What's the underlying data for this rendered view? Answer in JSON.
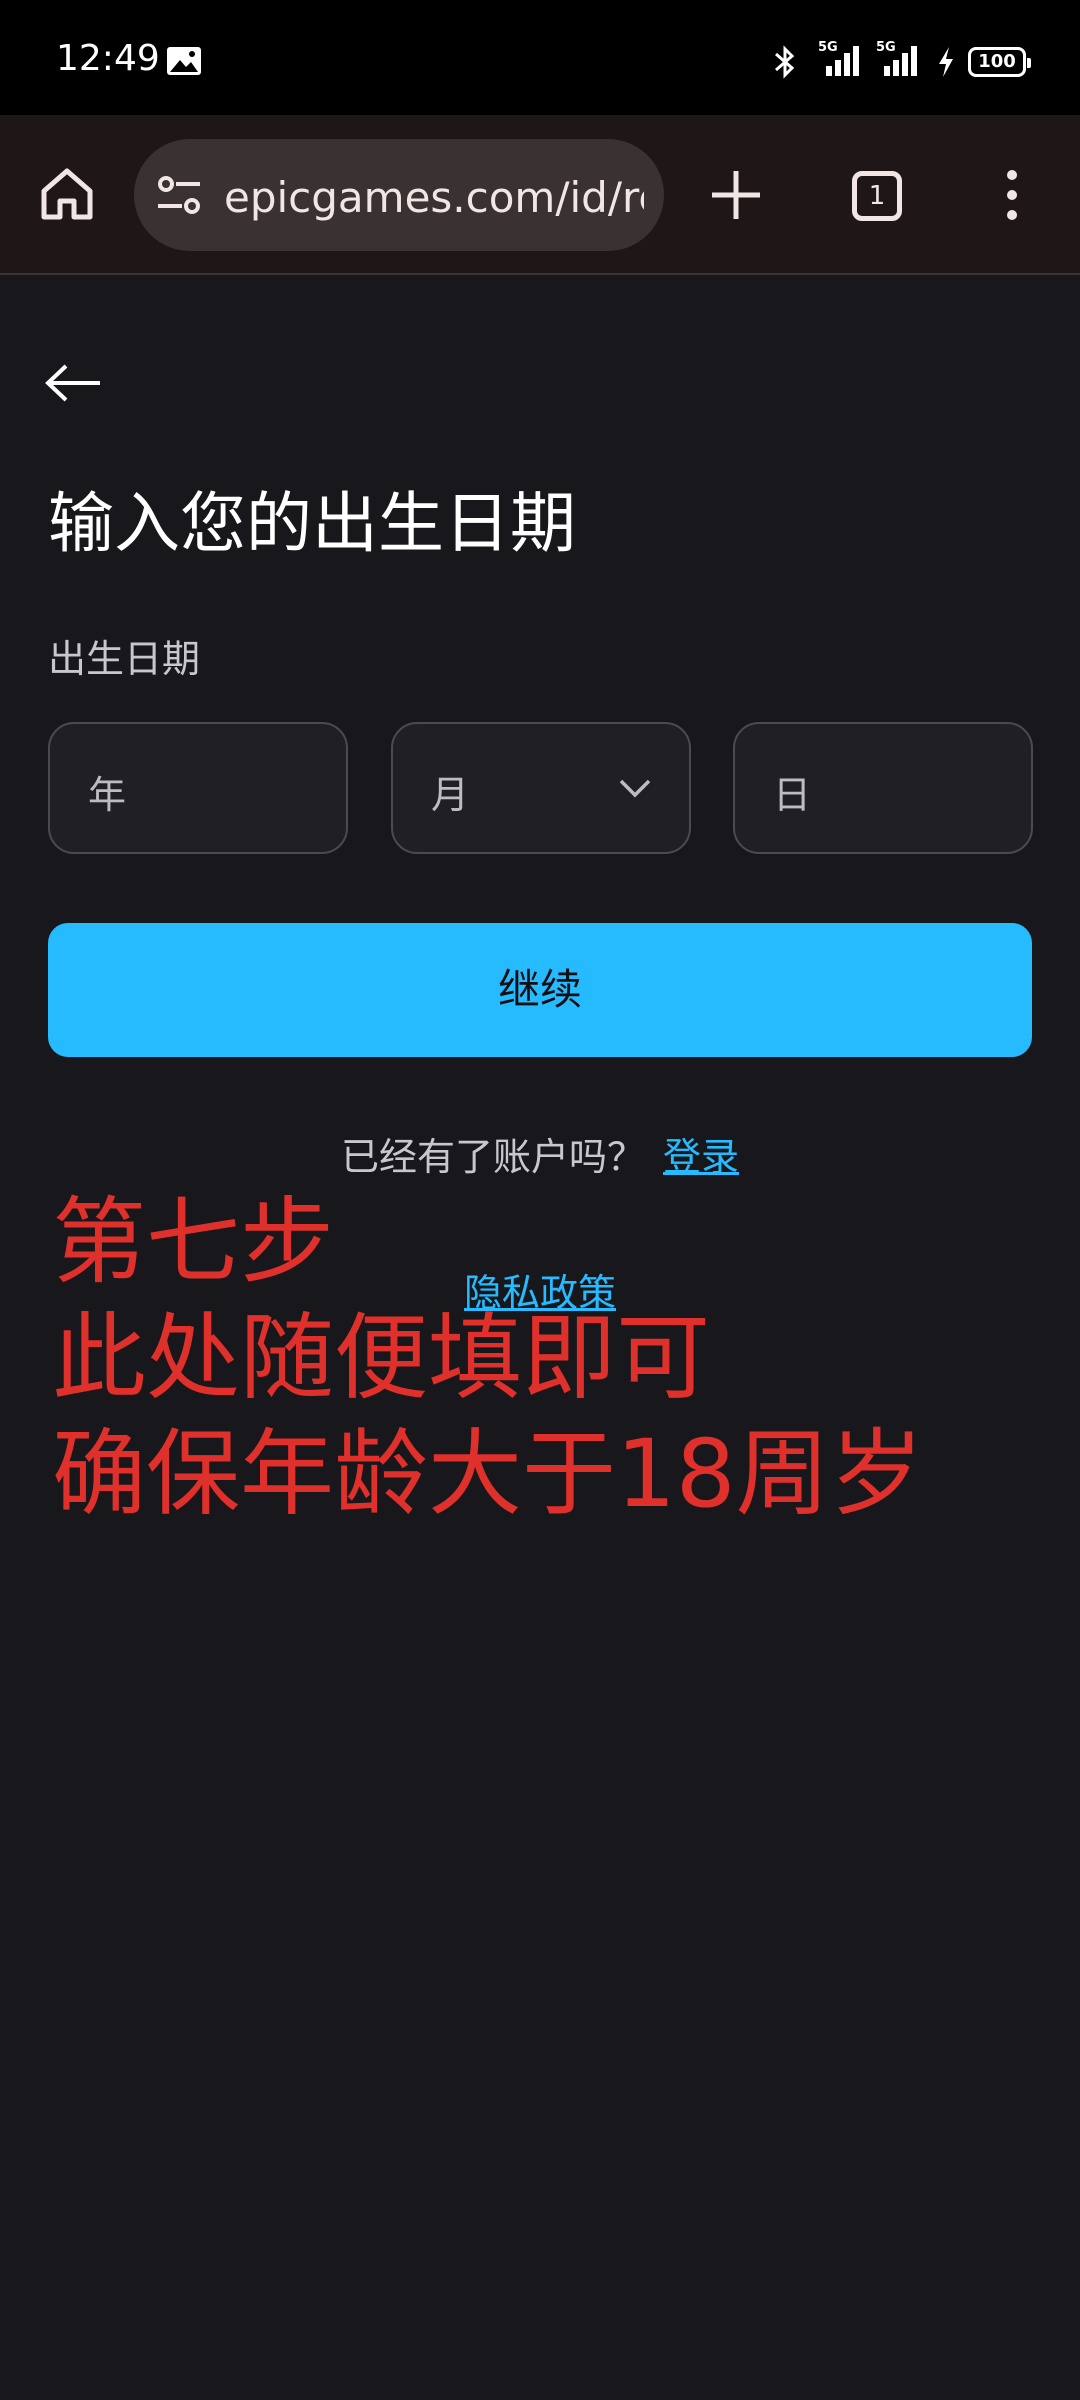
{
  "status_bar": {
    "time": "12:49",
    "signal_label_1": "5G",
    "signal_label_2": "5G",
    "battery": "100"
  },
  "browser": {
    "url": "epicgames.com/id/register",
    "tab_count": "1"
  },
  "page": {
    "title": "输入您的出生日期",
    "dob_label": "出生日期",
    "year_placeholder": "年",
    "month_placeholder": "月",
    "day_placeholder": "日",
    "continue_label": "继续",
    "have_account": "已经有了账户吗？",
    "login_link": "登录",
    "privacy_link": "隐私政策"
  },
  "annotation": {
    "line1": "第七步",
    "line2": "此处随便填即可",
    "line3": "确保年龄大于18周岁"
  },
  "colors": {
    "accent": "#26bbff",
    "annotation": "#e0302c",
    "background": "#18181c"
  },
  "icons": [
    "gallery-icon",
    "bluetooth-icon",
    "signal-icon",
    "charging-icon",
    "battery-icon",
    "home-icon",
    "tune-icon",
    "plus-icon",
    "tabs-icon",
    "more-vert-icon",
    "back-arrow-icon",
    "chevron-down-icon"
  ]
}
